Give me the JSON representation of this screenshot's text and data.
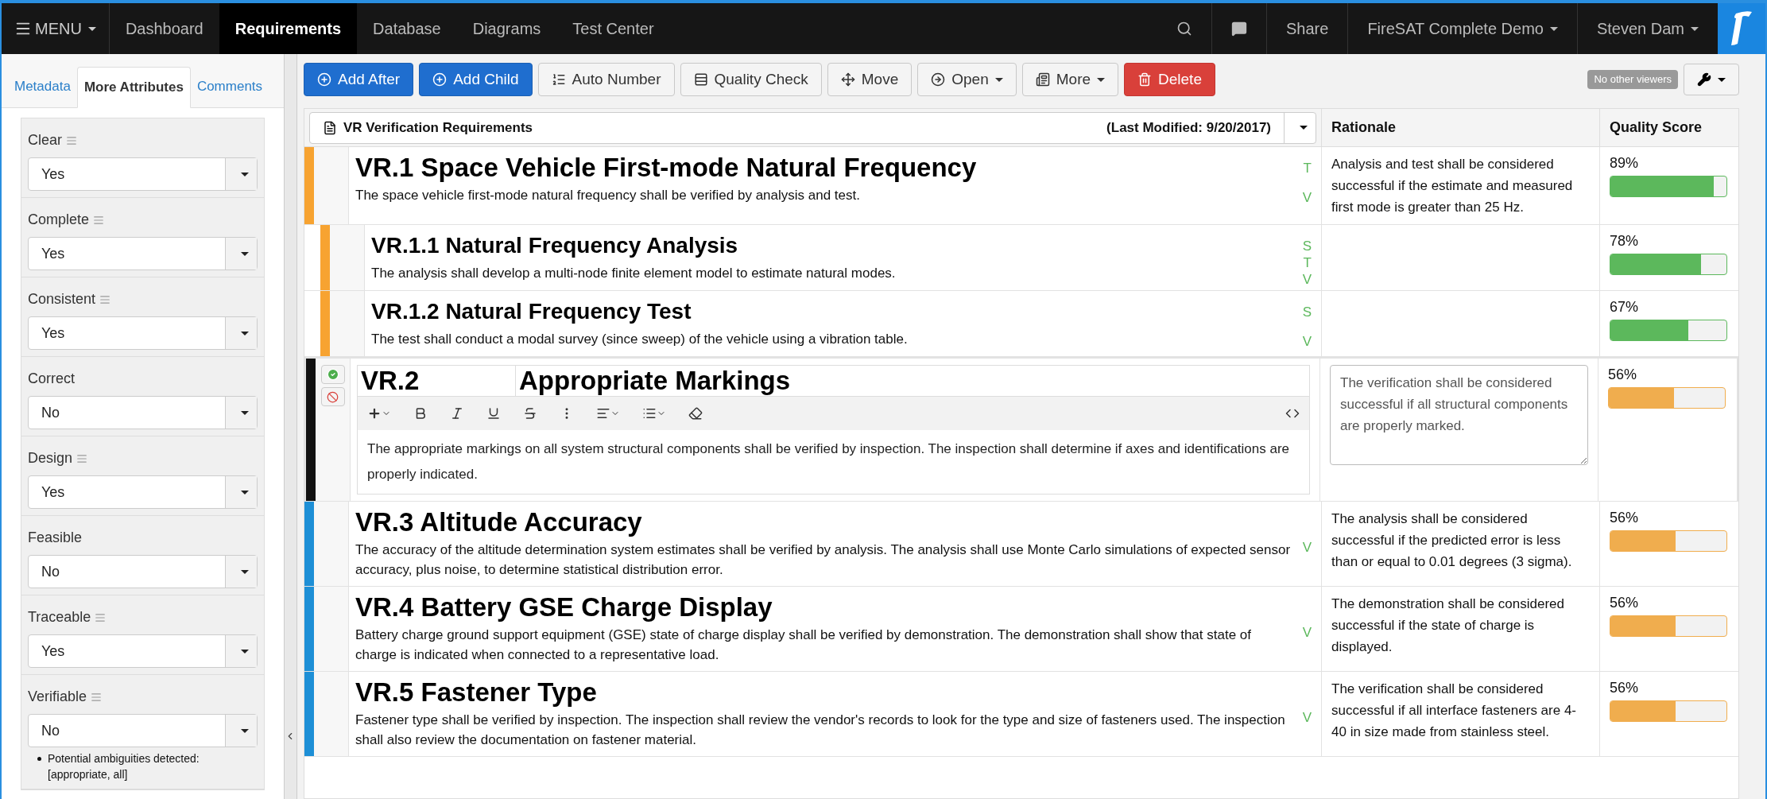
{
  "nav": {
    "menu": "MENU",
    "tabs": [
      {
        "label": "Dashboard",
        "selected": false
      },
      {
        "label": "Requirements",
        "selected": true
      },
      {
        "label": "Database",
        "selected": false
      },
      {
        "label": "Diagrams",
        "selected": false
      },
      {
        "label": "Test Center",
        "selected": false
      }
    ],
    "share": "Share",
    "project": "FireSAT Complete Demo",
    "user": "Steven Dam"
  },
  "sidebar": {
    "tabs": [
      {
        "label": "Metadata",
        "selected": false
      },
      {
        "label": "More Attributes",
        "selected": true
      },
      {
        "label": "Comments",
        "selected": false
      }
    ],
    "attributes": [
      {
        "label": "Clear",
        "described": true,
        "value": "Yes"
      },
      {
        "label": "Complete",
        "described": true,
        "value": "Yes"
      },
      {
        "label": "Consistent",
        "described": true,
        "value": "Yes"
      },
      {
        "label": "Correct",
        "described": false,
        "value": "No"
      },
      {
        "label": "Design",
        "described": true,
        "value": "Yes"
      },
      {
        "label": "Feasible",
        "described": false,
        "value": "No"
      },
      {
        "label": "Traceable",
        "described": true,
        "value": "Yes"
      },
      {
        "label": "Verifiable",
        "described": true,
        "value": "No",
        "notes": [
          "Potential ambiguities detected: [appropriate, all]"
        ]
      }
    ]
  },
  "toolbar": {
    "buttons": [
      {
        "label": "Add After",
        "kind": "primary",
        "dropdown": false
      },
      {
        "label": "Add Child",
        "kind": "primary",
        "dropdown": false
      },
      {
        "label": "Auto Number",
        "kind": "default",
        "dropdown": false
      },
      {
        "label": "Quality Check",
        "kind": "default",
        "dropdown": false
      },
      {
        "label": "Move",
        "kind": "default",
        "dropdown": false
      },
      {
        "label": "Open",
        "kind": "default",
        "dropdown": true
      },
      {
        "label": "More",
        "kind": "default",
        "dropdown": true
      },
      {
        "label": "Delete",
        "kind": "danger",
        "dropdown": false
      }
    ],
    "viewers": "No other viewers"
  },
  "table": {
    "document": "VR Verification Requirements",
    "last_modified": "(Last Modified: 9/20/2017)",
    "columns": [
      "Rationale",
      "Quality Score"
    ],
    "rows": [
      {
        "number": "VR.1",
        "title": "Space Vehicle First-mode Natural Frequency",
        "description": "The space vehicle first-mode natural frequency shall be verified by analysis and test.",
        "color": "#f7a331",
        "editing": false,
        "methods": [
          "T",
          "V"
        ],
        "rationale": "Analysis and test shall be considered successful if the estimate and measured first mode is greater than 25 Hz.",
        "score": "89%",
        "level": 0.89,
        "children": [
          {
            "number": "VR.1.1",
            "title": "Natural Frequency Analysis",
            "description": "The analysis shall develop a multi-node finite element model to estimate natural modes.",
            "color": "#f7a331",
            "editing": false,
            "methods": [
              "S",
              "T",
              "V"
            ],
            "score": "78%",
            "level": 0.78
          },
          {
            "number": "VR.1.2",
            "title": "Natural Frequency Test",
            "description": "The test shall conduct a modal survey (since sweep) of the vehicle using a vibration table.",
            "color": "#f7a331",
            "editing": false,
            "methods": [
              "S",
              "V"
            ],
            "score": "67%",
            "level": 0.67
          }
        ]
      },
      {
        "number": "VR.2",
        "title": "Appropriate Markings",
        "description": "The appropriate markings on all system structural components shall be verified by inspection. The inspection shall determine if axes and identifications are properly indicated.",
        "color": "#111111",
        "editing": true,
        "rationale": "The verification shall be considered successful if all structural components are properly marked.",
        "score": "56%",
        "level": 0.56
      },
      {
        "number": "VR.3",
        "title": "Altitude Accuracy",
        "description": "The accuracy of the altitude determination system estimates shall be verified by analysis. The analysis shall use Monte Carlo simulations of expected sensor accuracy, plus noise, to determine statistical distribution error.",
        "color": "#1d8fd6",
        "editing": false,
        "methods": [
          "V"
        ],
        "rationale": "The analysis shall be considered successful if the predicted error is less than or equal to 0.01 degrees (3 sigma).",
        "score": "56%",
        "level": 0.56
      },
      {
        "number": "VR.4",
        "title": "Battery GSE Charge Display",
        "description": "Battery charge ground support equipment (GSE) state of charge display shall be verified by demonstration. The demonstration shall show that state of charge is indicated when connected to a representative load.",
        "color": "#1d8fd6",
        "editing": false,
        "methods": [
          "V"
        ],
        "rationale": "The demonstration shall be considered successful if the state of charge is displayed.",
        "score": "56%",
        "level": 0.56
      },
      {
        "number": "VR.5",
        "title": "Fastener Type",
        "description": "Fastener type shall be verified by inspection. The inspection shall review the vendor's records to look for the type and size of fasteners used. The inspection shall also review the documentation on fastener material.",
        "color": "#1d8fd6",
        "editing": false,
        "methods": [
          "V"
        ],
        "rationale": "The verification shall be considered successful if all interface fasteners are 4-40 in size made from stainless steel.",
        "score": "56%",
        "level": 0.56
      }
    ]
  }
}
